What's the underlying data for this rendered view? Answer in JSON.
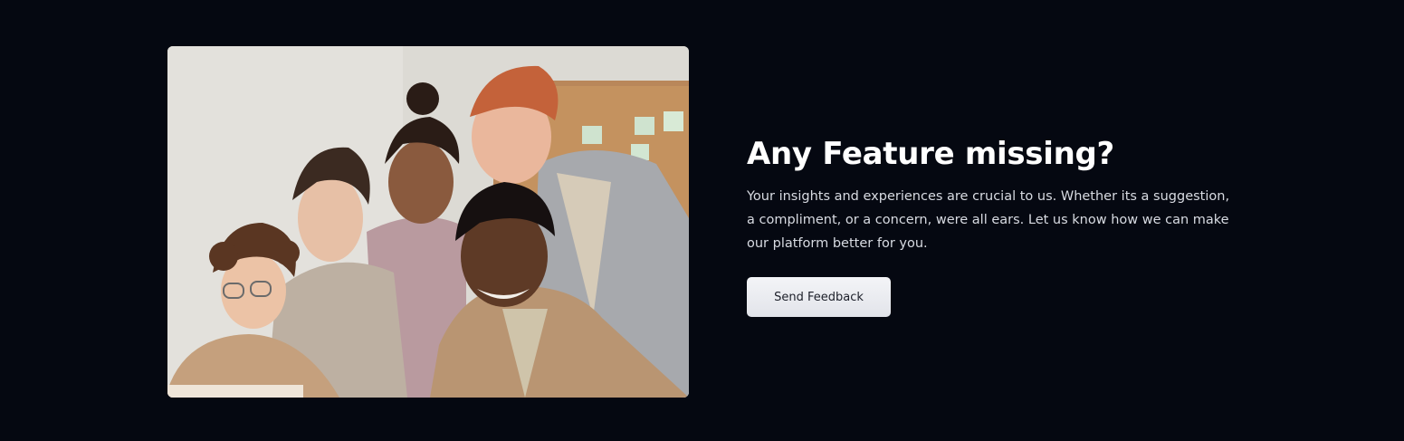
{
  "feature_section": {
    "headline": "Any Feature missing?",
    "body": "Your insights and experiences are crucial to us. Whether its a suggestion, a compliment, or a concern, were all ears. Let us know how we can make our platform better for you.",
    "cta_label": "Send Feedback"
  },
  "colors": {
    "page_background": "#050811",
    "headline": "#ffffff",
    "body_text": "#d8dbe2",
    "button_background": "#eceef2",
    "button_text": "#1c1f29"
  },
  "photo": {
    "icon": "team-photo"
  }
}
